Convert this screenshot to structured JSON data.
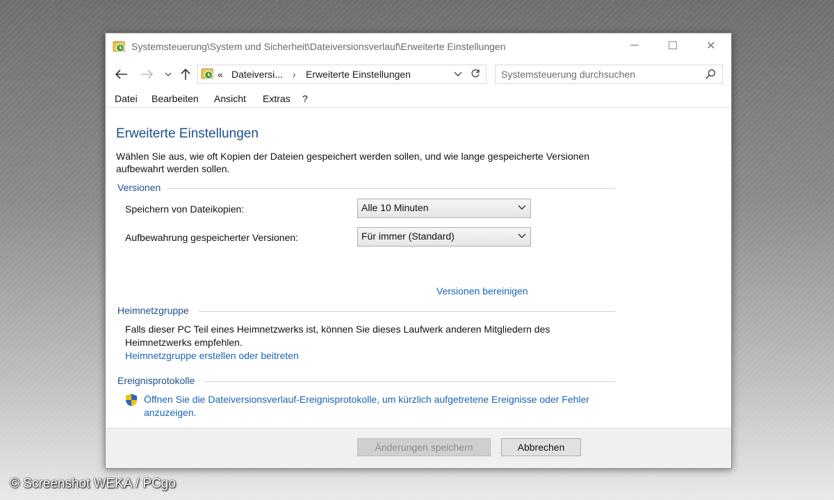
{
  "window": {
    "title": "Systemsteuerung\\System und Sicherheit\\Dateiversionsverlauf\\Erweiterte Einstellungen",
    "minimize": "─",
    "maximize": "☐",
    "close": "✕"
  },
  "address": {
    "overflow": "«",
    "crumb1": "Dateiversi...",
    "separator": "›",
    "crumb2": "Erweiterte Einstellungen"
  },
  "search": {
    "placeholder": "Systemsteuerung durchsuchen"
  },
  "menu": {
    "items": [
      "Datei",
      "Bearbeiten",
      "Ansicht",
      "Extras",
      "?"
    ]
  },
  "main": {
    "title": "Erweiterte Einstellungen",
    "description": "Wählen Sie aus, wie oft Kopien der Dateien gespeichert werden sollen, und wie lange gespeicherte Versionen aufbewahrt werden sollen."
  },
  "versionen": {
    "heading": "Versionen",
    "save_label": "Speichern von Dateikopien:",
    "save_value": "Alle 10 Minuten",
    "keep_label": "Aufbewahrung gespeicherter Versionen:",
    "keep_value": "Für immer (Standard)",
    "cleanup_link": "Versionen bereinigen"
  },
  "heimnetzgruppe": {
    "heading": "Heimnetzgruppe",
    "text": "Falls dieser PC Teil eines Heimnetzwerks ist, können Sie dieses Laufwerk anderen Mitgliedern des Heimnetzwerks empfehlen.",
    "link": "Heimnetzgruppe erstellen oder beitreten"
  },
  "ereignisprotokolle": {
    "heading": "Ereignisprotokolle",
    "link": "Öffnen Sie die Dateiversionsverlauf-Ereignisprotokolle, um kürzlich aufgetretene Ereignisse oder Fehler anzuzeigen."
  },
  "footer": {
    "save_button": "Änderungen speichern",
    "cancel_button": "Abbrechen"
  },
  "watermark": "© Screenshot WEKA / PCgo",
  "colors": {
    "heading_blue": "#1e4f8c",
    "link_blue": "#1a63b5"
  }
}
